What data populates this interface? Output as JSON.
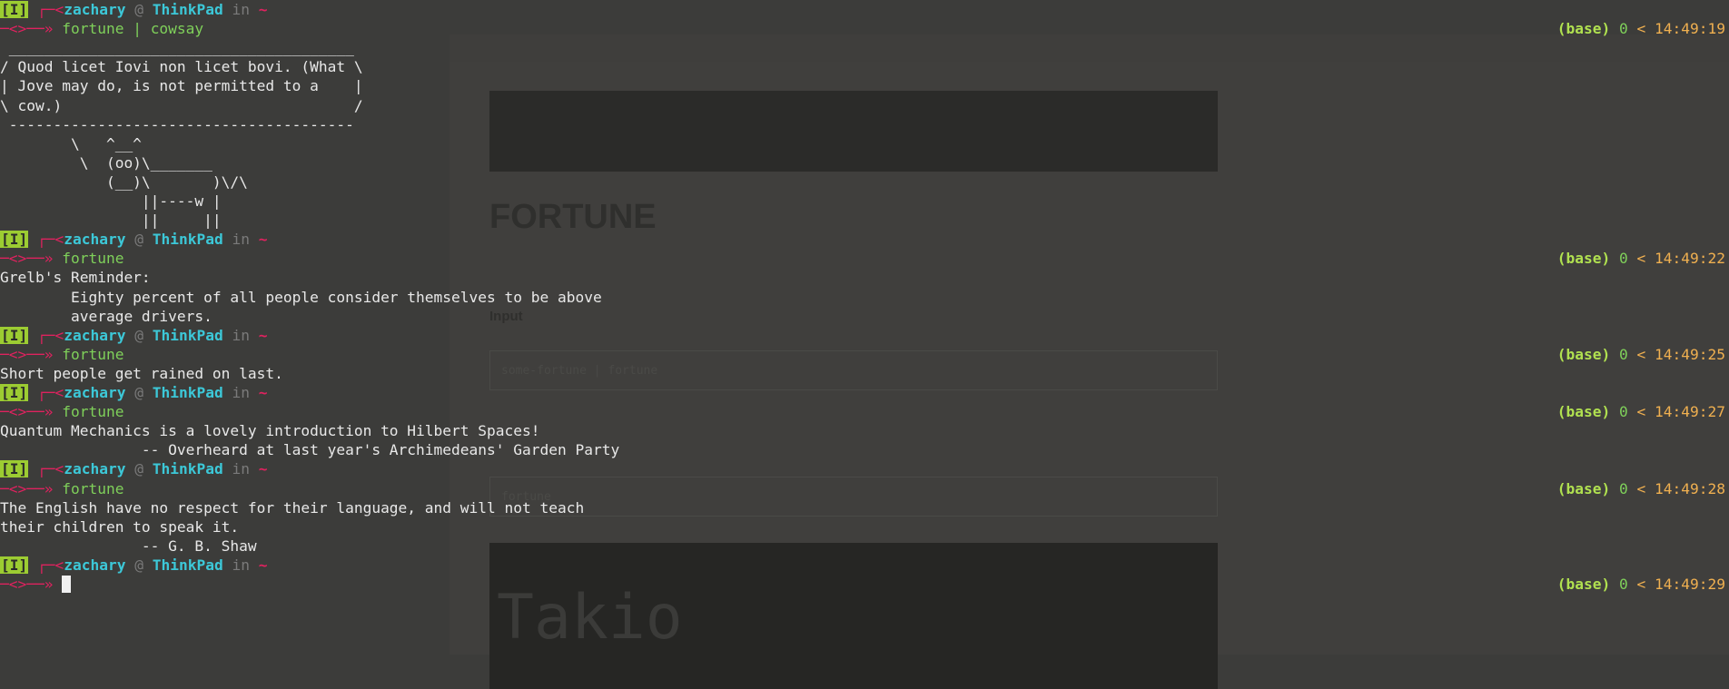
{
  "prompt": {
    "mode": "[I]",
    "user": "zachary",
    "at": "@",
    "host": "ThinkPad",
    "in": "in",
    "dir": "~",
    "arrow_top": "┌─<",
    "arrow_mid": "─<>──»",
    "env": "(base)",
    "code": "0",
    "lt": "<"
  },
  "blocks": [
    {
      "command": "fortune | cowsay",
      "time": "14:49:19",
      "output": [
        " _______________________________________",
        "/ Quod licet Iovi non licet bovi. (What \\",
        "| Jove may do, is not permitted to a    |",
        "\\ cow.)                                 /",
        " ---------------------------------------",
        "        \\   ^__^",
        "         \\  (oo)\\_______",
        "            (__)\\       )\\/\\",
        "                ||----w |",
        "                ||     ||"
      ]
    },
    {
      "command": "fortune",
      "time": "14:49:22",
      "output": [
        "Grelb's Reminder:",
        "        Eighty percent of all people consider themselves to be above",
        "        average drivers."
      ]
    },
    {
      "command": "fortune",
      "time": "14:49:25",
      "output": [
        "Short people get rained on last."
      ]
    },
    {
      "command": "fortune",
      "time": "14:49:27",
      "output": [
        "Quantum Mechanics is a lovely introduction to Hilbert Spaces!",
        "                -- Overheard at last year's Archimedeans' Garden Party"
      ]
    },
    {
      "command": "fortune",
      "time": "14:49:28",
      "output": [
        "The English have no respect for their language, and will not teach",
        "their children to speak it.",
        "                -- G. B. Shaw"
      ]
    },
    {
      "command": "",
      "time": "14:49:29",
      "output": []
    }
  ],
  "background": {
    "title": "FORTUNE",
    "label": "Input",
    "input_text": "some-fortune | fortune",
    "box2_text": "fortune",
    "banner_text": "Takio"
  }
}
